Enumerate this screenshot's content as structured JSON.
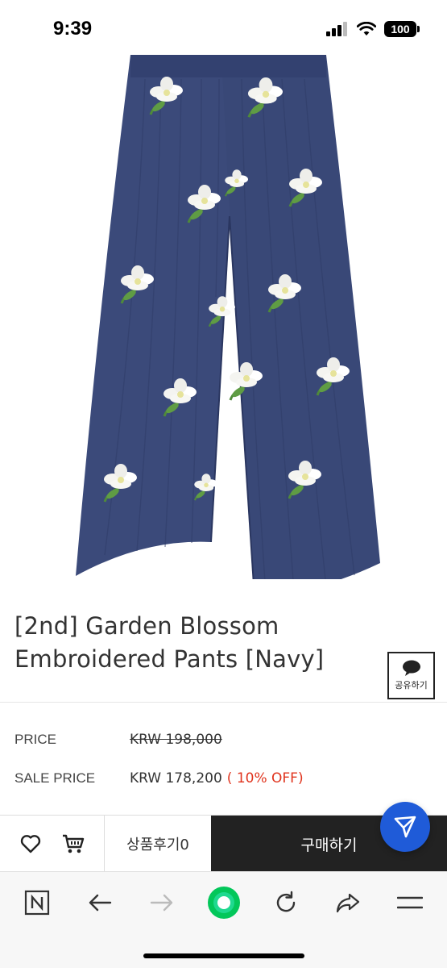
{
  "status_bar": {
    "time": "9:39",
    "battery": "100"
  },
  "product": {
    "image_alt": "Navy embroidered pants with white flowers",
    "title": "[2nd] Garden Blossom Embroidered Pants [Navy]"
  },
  "share": {
    "label": "공유하기"
  },
  "prices": {
    "price_label": "PRICE",
    "price_value": "KRW 198,000",
    "sale_label": "SALE PRICE",
    "sale_value": "KRW 178,200",
    "discount": "( 10% OFF)"
  },
  "action_bar": {
    "review_label": "상품후기0",
    "buy_label": "구매하기"
  },
  "colors": {
    "navy": "#3b4a7a",
    "sale_red": "#e0341e",
    "buy_dark": "#222222",
    "fab_blue": "#1f5bd8",
    "naver_green": "#03c75a"
  }
}
